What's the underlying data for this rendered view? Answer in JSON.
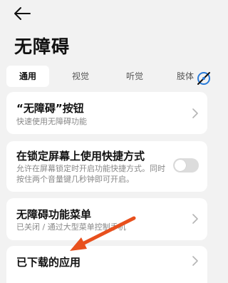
{
  "page": {
    "title": "无障碍"
  },
  "tabs": [
    "通用",
    "视觉",
    "听觉",
    "肢体"
  ],
  "items": [
    {
      "title": "“无障碍”按钮",
      "subtitle": "快速使用无障碍功能"
    },
    {
      "title": "在锁定屏幕上使用快捷方式",
      "subtitle_lines": [
        "允许在屏幕锁定时开启功能快捷方式。同时",
        "按住两个音量键几秒钟即可开启。"
      ],
      "toggle_on": false
    },
    {
      "title": "无障碍功能菜单",
      "subtitle": "已关闭 / 通过大型菜单控制手机"
    },
    {
      "title": "已下载的应用"
    }
  ],
  "colors": {
    "annotation_arrow": "#e8501d",
    "toggle_off": "#dcdcdc",
    "edge_icon": "#2a7bd8"
  },
  "icons": {
    "back": "back-arrow-icon",
    "chevron": "chevron-right-icon",
    "edge": "edge-swipe-icon"
  }
}
